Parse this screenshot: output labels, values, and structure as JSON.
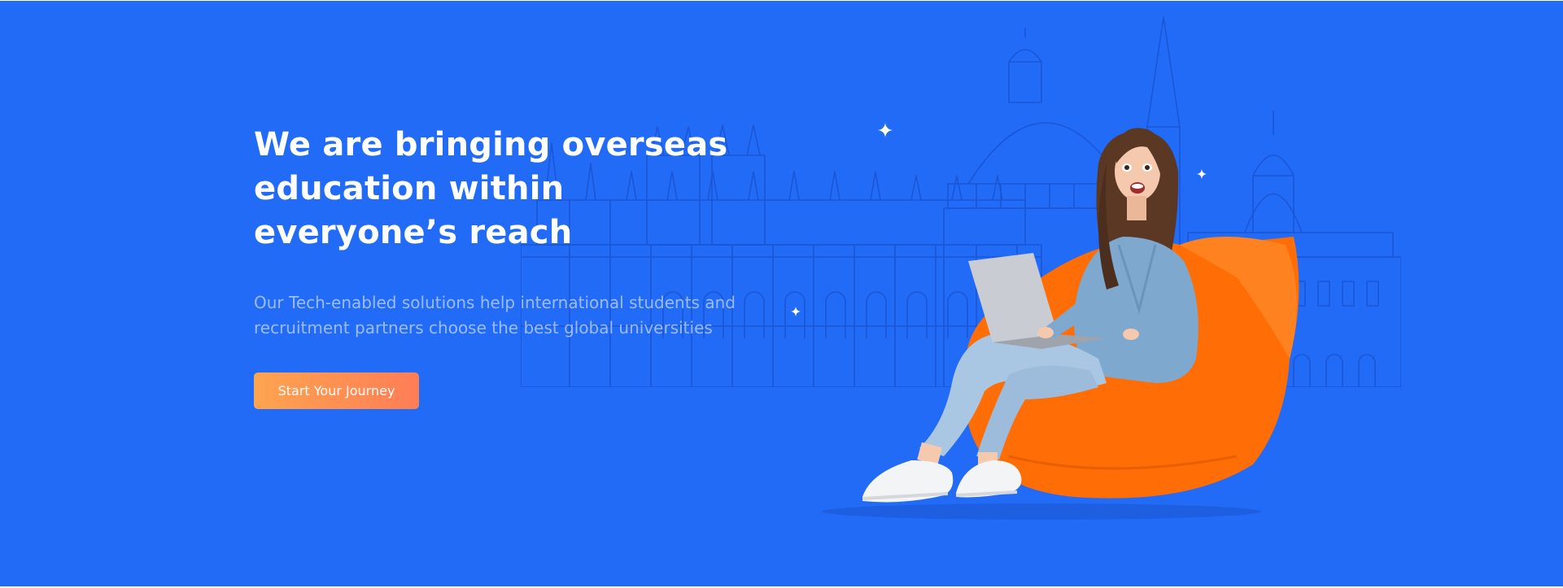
{
  "hero": {
    "title": "We are bringing overseas education within everyone’s reach",
    "subtitle": "Our Tech-enabled solutions help international students and recruitment partners choose the best global universities",
    "cta_label": "Start Your Journey"
  },
  "colors": {
    "background": "#226bf7",
    "cta_gradient_start": "#fda44f",
    "cta_gradient_end": "#fe7d56",
    "beanbag": "#ff6d06",
    "skyline_line": "#1a56d6"
  },
  "icons": [
    "sparkle-icon",
    "university-skyline-illustration",
    "student-on-beanbag-illustration"
  ]
}
